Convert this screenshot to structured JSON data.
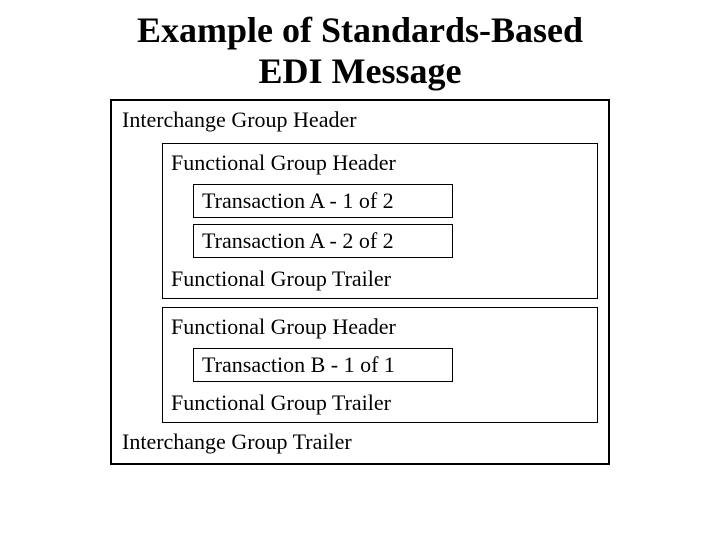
{
  "title_line1": "Example of Standards-Based",
  "title_line2": "EDI Message",
  "interchange": {
    "header": "Interchange Group Header",
    "trailer": "Interchange Group Trailer",
    "groups": [
      {
        "header": "Functional Group Header",
        "trailer": "Functional Group Trailer",
        "transactions": [
          "Transaction A - 1 of 2",
          "Transaction  A - 2 of 2"
        ]
      },
      {
        "header": "Functional Group Header",
        "trailer": "Functional Group Trailer",
        "transactions": [
          "Transaction  B - 1 of 1"
        ]
      }
    ]
  }
}
